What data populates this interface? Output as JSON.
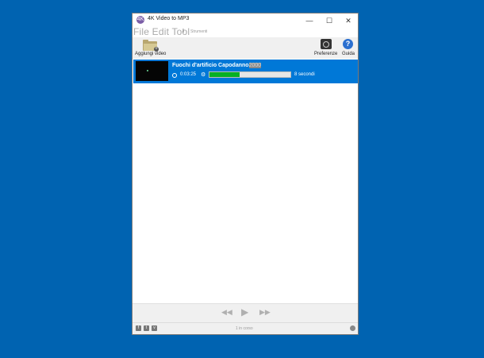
{
  "window": {
    "title": "4K Video to MP3",
    "app_icon": "4K"
  },
  "titlebar": {
    "minimize": "—",
    "maximize": "☐",
    "close": "✕"
  },
  "menubar": {
    "main": "File Edit Tool",
    "cursor": "I",
    "extra": "Strumenti"
  },
  "toolbar": {
    "add_video_label": "Aggiungi video",
    "preferences_label": "Preferenze",
    "help_label": "Guida",
    "help_glyph": "?"
  },
  "download": {
    "title": "Fuochi d'artificio Capodanno",
    "title_selected": "2000",
    "duration": "0:03:25",
    "progress_fraction": 0.37,
    "remaining": "8 secondi"
  },
  "player": {
    "rewind": "◀◀",
    "play": "▶",
    "forward": "▶▶"
  },
  "statusbar": {
    "facebook": "f",
    "twitter": "t",
    "vimeo": "v",
    "status_text": "1 in corso"
  },
  "colors": {
    "desktop": "#0063b1",
    "selected_row": "#0078d7",
    "progress_fill": "#06b025"
  }
}
